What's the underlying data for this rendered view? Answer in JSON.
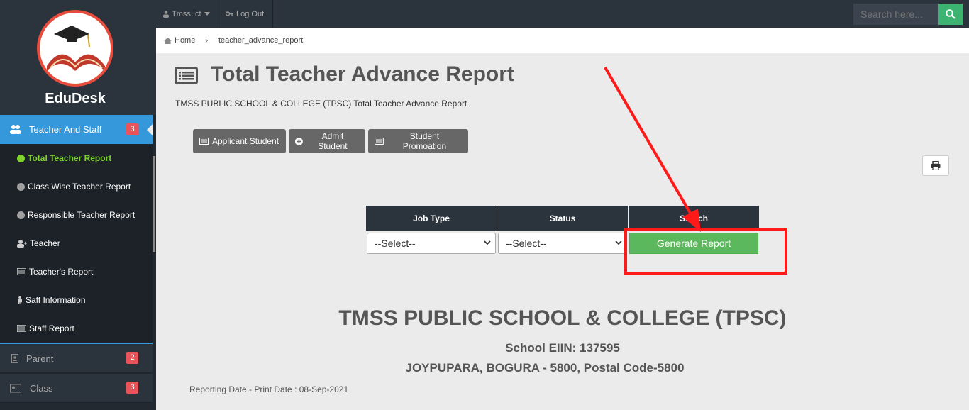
{
  "app": {
    "name": "EduDesk"
  },
  "sidebar": {
    "active_menu": {
      "label": "Teacher And Staff",
      "badge": "3",
      "icon": "users-icon"
    },
    "submenu": [
      {
        "label": "Total Teacher Report",
        "icon": "dot-icon",
        "active": true
      },
      {
        "label": "Class Wise Teacher Report",
        "icon": "dot-icon"
      },
      {
        "label": "Responsible Teacher Report",
        "icon": "dot-icon"
      },
      {
        "label": "Teacher",
        "icon": "user-plus-icon"
      },
      {
        "label": "Teacher's Report",
        "icon": "list-icon"
      },
      {
        "label": "Saff Information",
        "icon": "male-icon"
      },
      {
        "label": "Staff Report",
        "icon": "list-icon"
      }
    ],
    "menus": [
      {
        "label": "Parent",
        "badge": "2",
        "icon": "id-badge-icon"
      },
      {
        "label": "Class",
        "badge": "3",
        "icon": "id-card-icon"
      }
    ]
  },
  "topbar": {
    "user_label": "Tmss Ict",
    "logout_label": "Log Out",
    "search_placeholder": "Search here..."
  },
  "breadcrumb": {
    "home": "Home",
    "current": "teacher_advance_report"
  },
  "page": {
    "title": "Total Teacher Advance Report",
    "subtitle": "TMSS PUBLIC SCHOOL & COLLEGE (TPSC) Total Teacher Advance Report"
  },
  "actions": [
    {
      "label": "Applicant Student",
      "icon": "list-icon"
    },
    {
      "label": "Admit Student",
      "icon": "plus-circle-icon"
    },
    {
      "label": "Student Promoation",
      "icon": "list-icon"
    }
  ],
  "filter": {
    "headers": [
      "Job Type",
      "Status",
      "Search"
    ],
    "job_type_value": "--Select--",
    "status_value": "--Select--",
    "generate_label": "Generate Report"
  },
  "report": {
    "school_name": "TMSS PUBLIC SCHOOL & COLLEGE (TPSC)",
    "eiin": "School EIIN: 137595",
    "address": "JOYPUPARA, BOGURA - 5800, Postal Code-5800",
    "date_line": "Reporting Date - Print Date : 08-Sep-2021"
  },
  "colors": {
    "accent": "#3498db",
    "success": "#5cb85c",
    "annotation": "#ff1a1a",
    "active_green": "#7fd12d"
  }
}
